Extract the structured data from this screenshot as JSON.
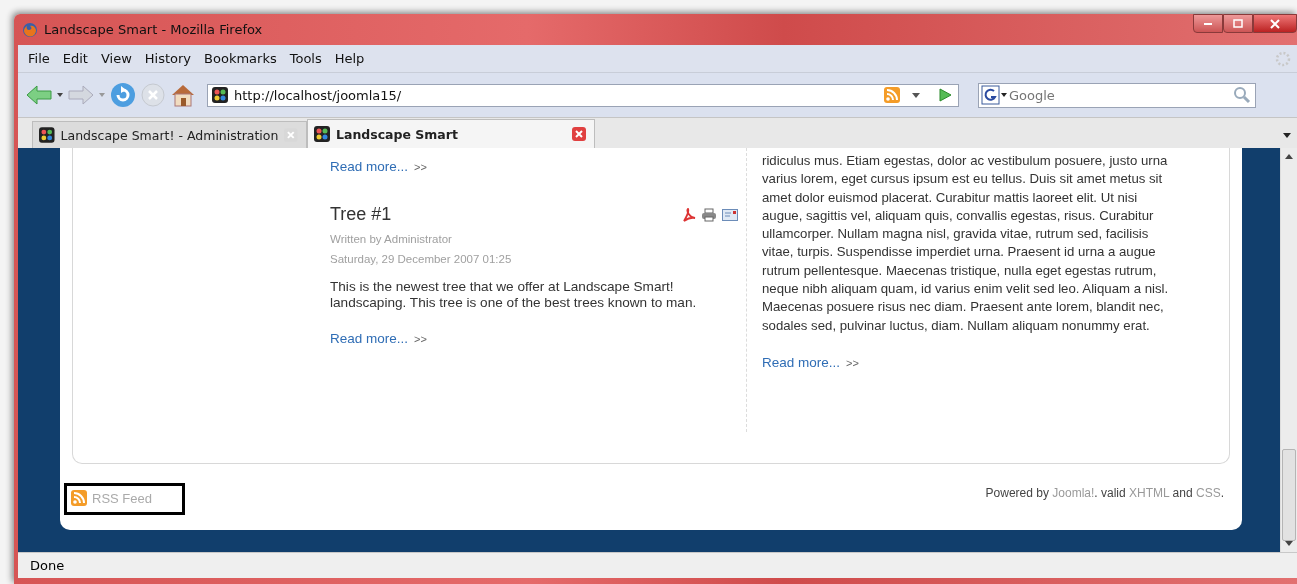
{
  "window": {
    "title": "Landscape Smart - Mozilla Firefox"
  },
  "menu": [
    "File",
    "Edit",
    "View",
    "History",
    "Bookmarks",
    "Tools",
    "Help"
  ],
  "address": {
    "value": "http://localhost/joomla15/"
  },
  "search": {
    "placeholder": "Google"
  },
  "tabs": [
    {
      "label": "Landscape Smart! - Administration",
      "selected": false
    },
    {
      "label": "Landscape Smart",
      "selected": true
    }
  ],
  "page": {
    "left": [
      {
        "kind": "readmore",
        "link": "Read more...",
        "arrow": ">>"
      },
      {
        "kind": "article",
        "title": "Tree #1",
        "author": "Written by Administrator",
        "date": "Saturday, 29 December 2007 01:25",
        "body": "This is the newest tree that we offer at Landscape Smart! landscaping. This tree is one of the best trees known to man.",
        "link": "Read more...",
        "arrow": ">>"
      }
    ],
    "right": {
      "body": "ridiculus mus. Etiam egestas, dolor ac vestibulum posuere, justo urna varius lorem, eget cursus ipsum est eu tellus. Duis sit amet metus sit amet dolor euismod placerat. Curabitur mattis laoreet elit. Ut nisi augue, sagittis vel, aliquam quis, convallis egestas, risus. Curabitur ullamcorper. Nullam magna nisl, gravida vitae, rutrum sed, facilisis vitae, turpis. Suspendisse imperdiet urna. Praesent id urna a augue rutrum pellentesque. Maecenas tristique, nulla eget egestas rutrum, neque nibh aliquam quam, id varius enim velit sed leo. Aliquam a nisl. Maecenas posuere risus nec diam. Praesent ante lorem, blandit nec, sodales sed, pulvinar luctus, diam. Nullam aliquam nonummy erat.",
      "link": "Read more...",
      "arrow": ">>"
    }
  },
  "footer": {
    "rss": "RSS Feed",
    "credits": [
      {
        "kind": "text",
        "text": "Powered by"
      },
      {
        "kind": "link",
        "text": "Joomla!"
      },
      {
        "kind": "text",
        "text": ". valid"
      },
      {
        "kind": "link",
        "text": "XHTML"
      },
      {
        "kind": "text",
        "text": "and"
      },
      {
        "kind": "link",
        "text": "CSS"
      },
      {
        "kind": "text",
        "text": "."
      }
    ]
  },
  "status_bar": "Done"
}
